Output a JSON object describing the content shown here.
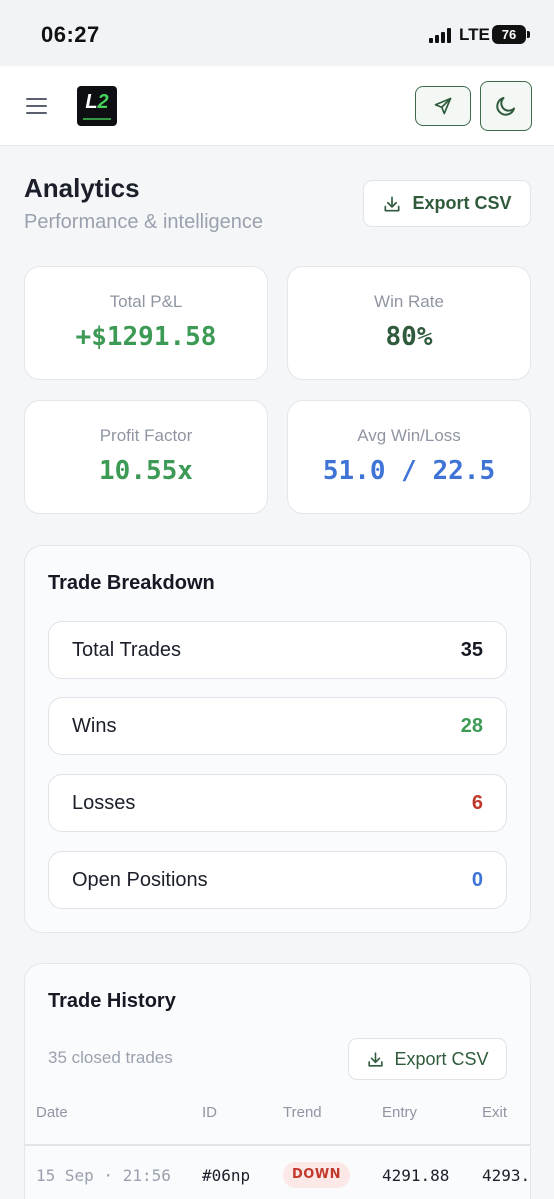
{
  "status_bar": {
    "time": "06:27",
    "network": "LTE",
    "battery": "76"
  },
  "header": {
    "logo_text_a": "L",
    "logo_text_b": "2"
  },
  "page": {
    "title": "Analytics",
    "subtitle": "Performance & intelligence",
    "export_label": "Export CSV"
  },
  "stats": [
    {
      "label": "Total P&L",
      "value": "+$1291.58",
      "color": "#3d9a55"
    },
    {
      "label": "Win Rate",
      "value": "80%",
      "color": "#2f5b3c"
    },
    {
      "label": "Profit Factor",
      "value": "10.55x",
      "color": "#3d9a55"
    },
    {
      "label": "Avg Win/Loss",
      "value": "51.0 / 22.5",
      "color": "#3f74d6"
    }
  ],
  "breakdown": {
    "title": "Trade Breakdown",
    "rows": [
      {
        "label": "Total Trades",
        "value": "35",
        "color": "#151924"
      },
      {
        "label": "Wins",
        "value": "28",
        "color": "#3d9a55"
      },
      {
        "label": "Losses",
        "value": "6",
        "color": "#c0392b"
      },
      {
        "label": "Open Positions",
        "value": "0",
        "color": "#3f74d6"
      }
    ]
  },
  "history": {
    "title": "Trade History",
    "subtitle": "35 closed trades",
    "export_label": "Export CSV",
    "columns": [
      "Date",
      "ID",
      "Trend",
      "Entry",
      "Exit"
    ],
    "rows": [
      {
        "date": "15 Sep · 21:56",
        "id": "#06np",
        "trend": "DOWN",
        "entry": "4291.88",
        "exit": "4293."
      }
    ]
  }
}
